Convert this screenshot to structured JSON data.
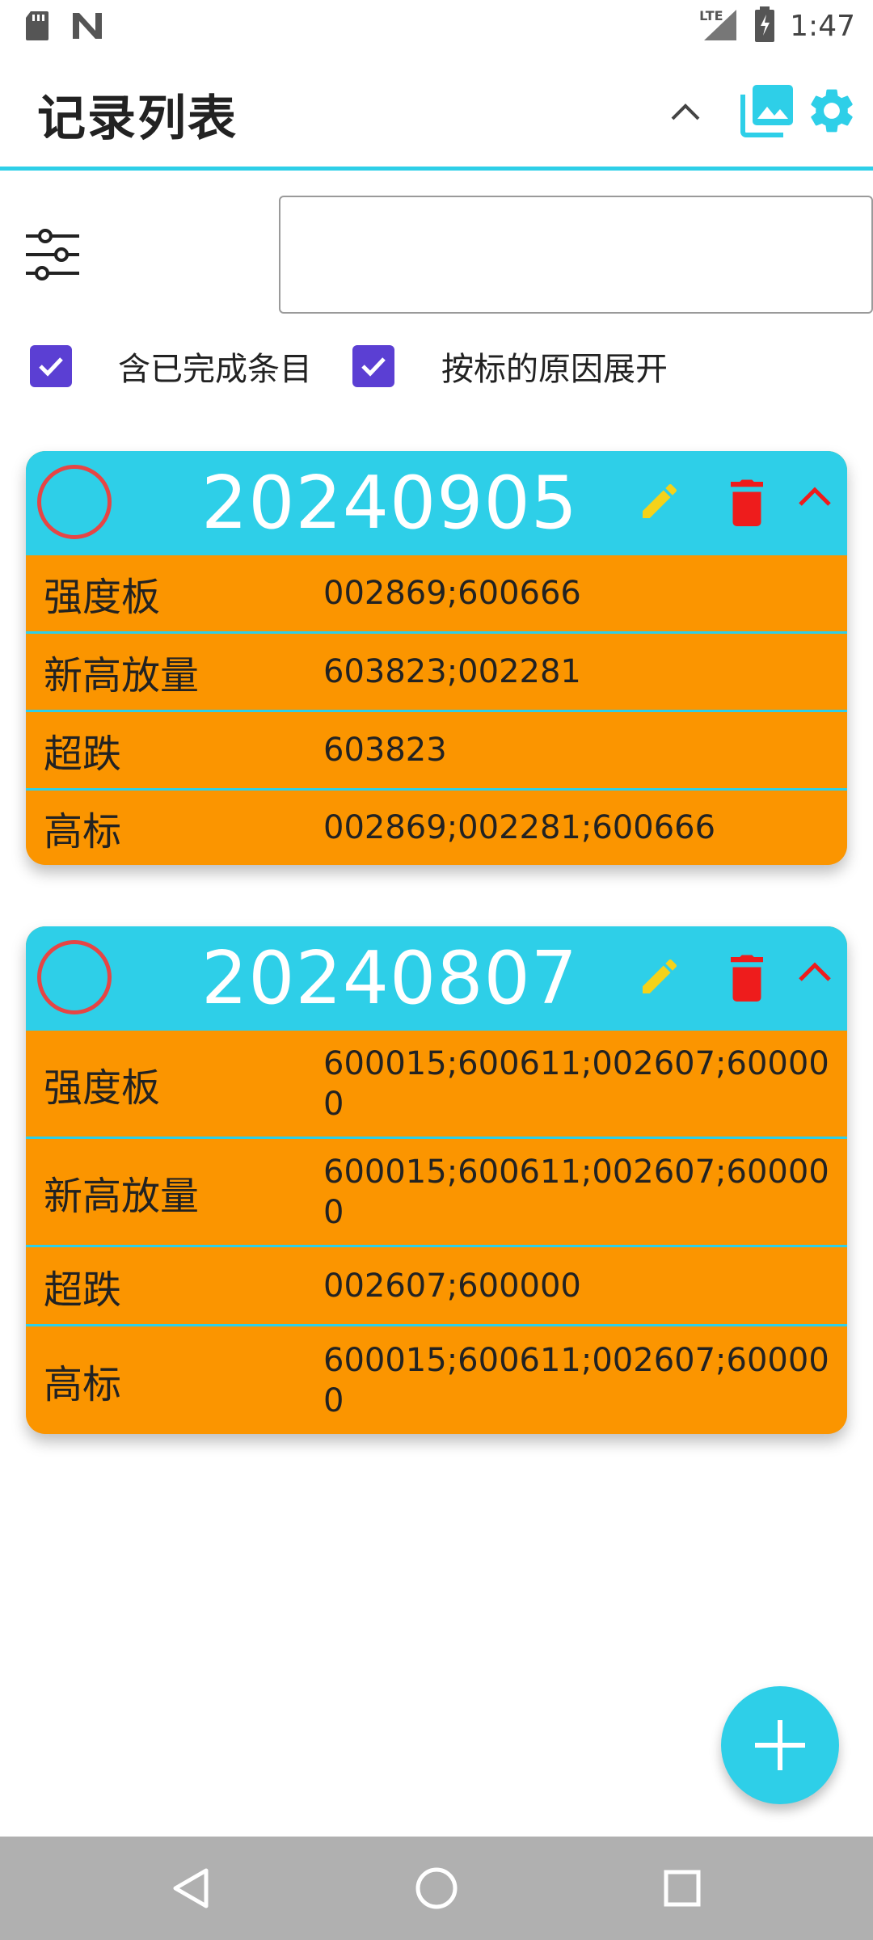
{
  "status_bar": {
    "time": "1:47",
    "network": "LTE",
    "icons": [
      "sd-card-icon",
      "n-logo-icon",
      "signal-icon",
      "battery-charging-icon"
    ]
  },
  "app_bar": {
    "title": "记录列表",
    "icons": [
      "chevron-up-icon",
      "gallery-icon",
      "settings-icon"
    ]
  },
  "filter": {
    "search_value": "",
    "include_completed_label": "含已完成条目",
    "include_completed_checked": true,
    "expand_by_reason_label": "按标的原因展开",
    "expand_by_reason_checked": true
  },
  "cards": [
    {
      "date": "20240905",
      "rows": [
        {
          "key": "强度板",
          "value": "002869;600666"
        },
        {
          "key": "新高放量",
          "value": "603823;002281"
        },
        {
          "key": "超跌",
          "value": "603823"
        },
        {
          "key": "高标",
          "value": "002869;002281;600666"
        }
      ]
    },
    {
      "date": "20240807",
      "rows": [
        {
          "key": "强度板",
          "value": "600015;600611;002607;600000"
        },
        {
          "key": "新高放量",
          "value": "600015;600611;002607;600000"
        },
        {
          "key": "超跌",
          "value": "002607;600000"
        },
        {
          "key": "高标",
          "value": "600015;600611;002607;600000"
        }
      ]
    }
  ],
  "colors": {
    "accent": "#2ecfe8",
    "card_body": "#fb9500",
    "checkbox": "#5b3fd3",
    "delete": "#ee1c1c",
    "edit": "#f5d21a",
    "circle": "#e64545"
  }
}
